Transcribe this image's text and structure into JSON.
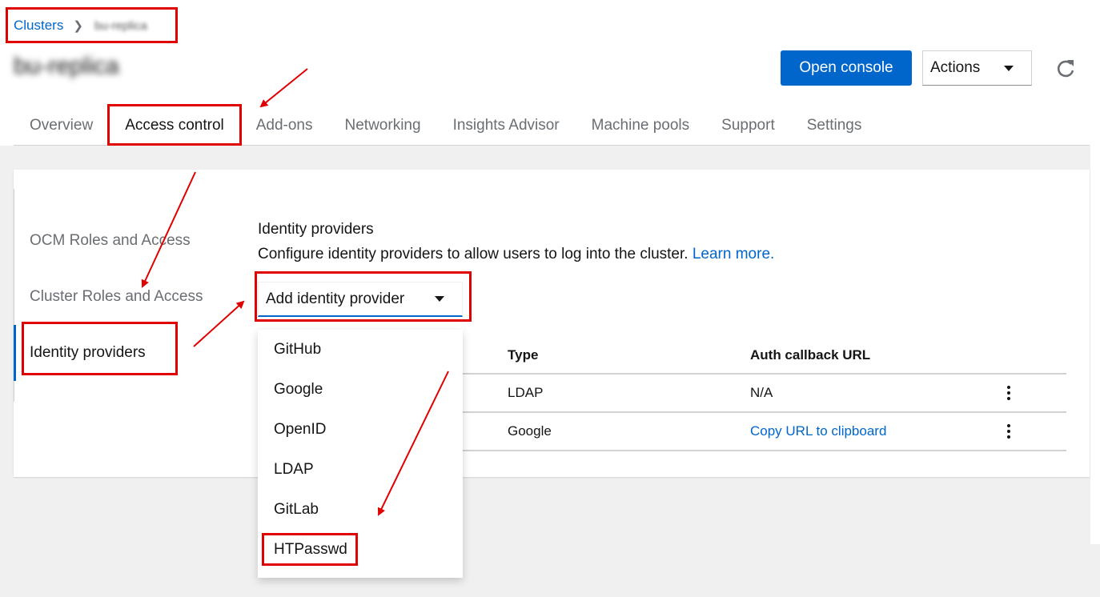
{
  "breadcrumb": {
    "root": "Clusters",
    "current": "bu-replica"
  },
  "page_title": "bu-replica",
  "header_actions": {
    "open_console": "Open console",
    "actions": "Actions"
  },
  "tabs": [
    {
      "label": "Overview"
    },
    {
      "label": "Access control"
    },
    {
      "label": "Add-ons"
    },
    {
      "label": "Networking"
    },
    {
      "label": "Insights Advisor"
    },
    {
      "label": "Machine pools"
    },
    {
      "label": "Support"
    },
    {
      "label": "Settings"
    }
  ],
  "sidenav": [
    {
      "label": "OCM Roles and Access"
    },
    {
      "label": "Cluster Roles and Access"
    },
    {
      "label": "Identity providers"
    }
  ],
  "identity_providers": {
    "title": "Identity providers",
    "description": "Configure identity providers to allow users to log into the cluster.",
    "learn_more": "Learn more.",
    "add_button": "Add identity provider",
    "menu_items": [
      "GitHub",
      "Google",
      "OpenID",
      "LDAP",
      "GitLab",
      "HTPasswd"
    ],
    "table": {
      "headers": {
        "type": "Type",
        "auth_callback_url": "Auth callback URL"
      },
      "rows": [
        {
          "type": "LDAP",
          "url": "N/A"
        },
        {
          "type": "Google",
          "url": "Copy URL to clipboard"
        }
      ]
    }
  },
  "colors": {
    "primary": "#0066cc",
    "annotation": "#e00000"
  }
}
